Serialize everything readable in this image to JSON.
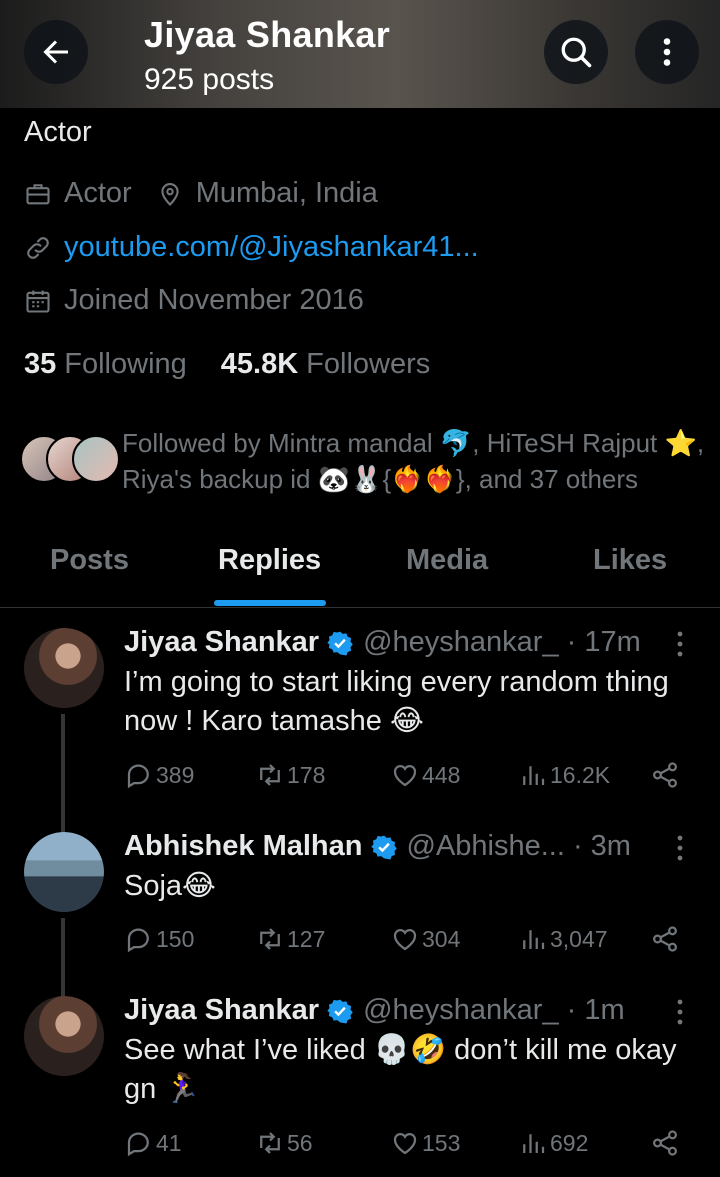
{
  "header": {
    "title": "Jiyaa Shankar",
    "subtitle": "925 posts"
  },
  "profile": {
    "bio": "Actor",
    "category": "Actor",
    "location": "Mumbai, India",
    "link": "youtube.com/@Jiyashankar41...",
    "joined": "Joined November 2016",
    "following_count": "35",
    "following_label": "Following",
    "followers_count": "45.8K",
    "followers_label": "Followers",
    "followed_by": "Followed by Mintra mandal 🐬, HiTeSH Rajput ⭐, Riya's backup id 🐼🐰{❤️‍🔥❤️‍🔥}, and 37 others"
  },
  "tabs": [
    {
      "label": "Posts"
    },
    {
      "label": "Replies"
    },
    {
      "label": "Media"
    },
    {
      "label": "Likes"
    }
  ],
  "active_tab": "Replies",
  "posts": [
    {
      "name": "Jiyaa Shankar",
      "handle": "@heyshankar_ · 17m",
      "text": "I’m going to start liking every random thing now ! Karo tamashe 😂",
      "replies": "389",
      "reposts": "178",
      "likes": "448",
      "views": "16.2K"
    },
    {
      "name": "Abhishek Malhan",
      "handle": "@Abhishe... · 3m",
      "text": "Soja😂",
      "replies": "150",
      "reposts": "127",
      "likes": "304",
      "views": "3,047"
    },
    {
      "name": "Jiyaa Shankar",
      "handle": "@heyshankar_ · 1m",
      "text": "See what I’ve liked 💀🤣 don’t kill me okay gn 🏃‍♀️",
      "replies": "41",
      "reposts": "56",
      "likes": "153",
      "views": "692"
    }
  ],
  "colors": {
    "accent": "#1d9bf0",
    "muted": "#71767b",
    "text": "#e7e9ea",
    "background": "#000000"
  },
  "icons": [
    "back-arrow-icon",
    "search-icon",
    "more-vertical-icon",
    "briefcase-icon",
    "location-pin-icon",
    "link-icon",
    "calendar-icon",
    "verified-badge-icon",
    "reply-icon",
    "repost-icon",
    "like-icon",
    "views-icon",
    "share-icon"
  ]
}
